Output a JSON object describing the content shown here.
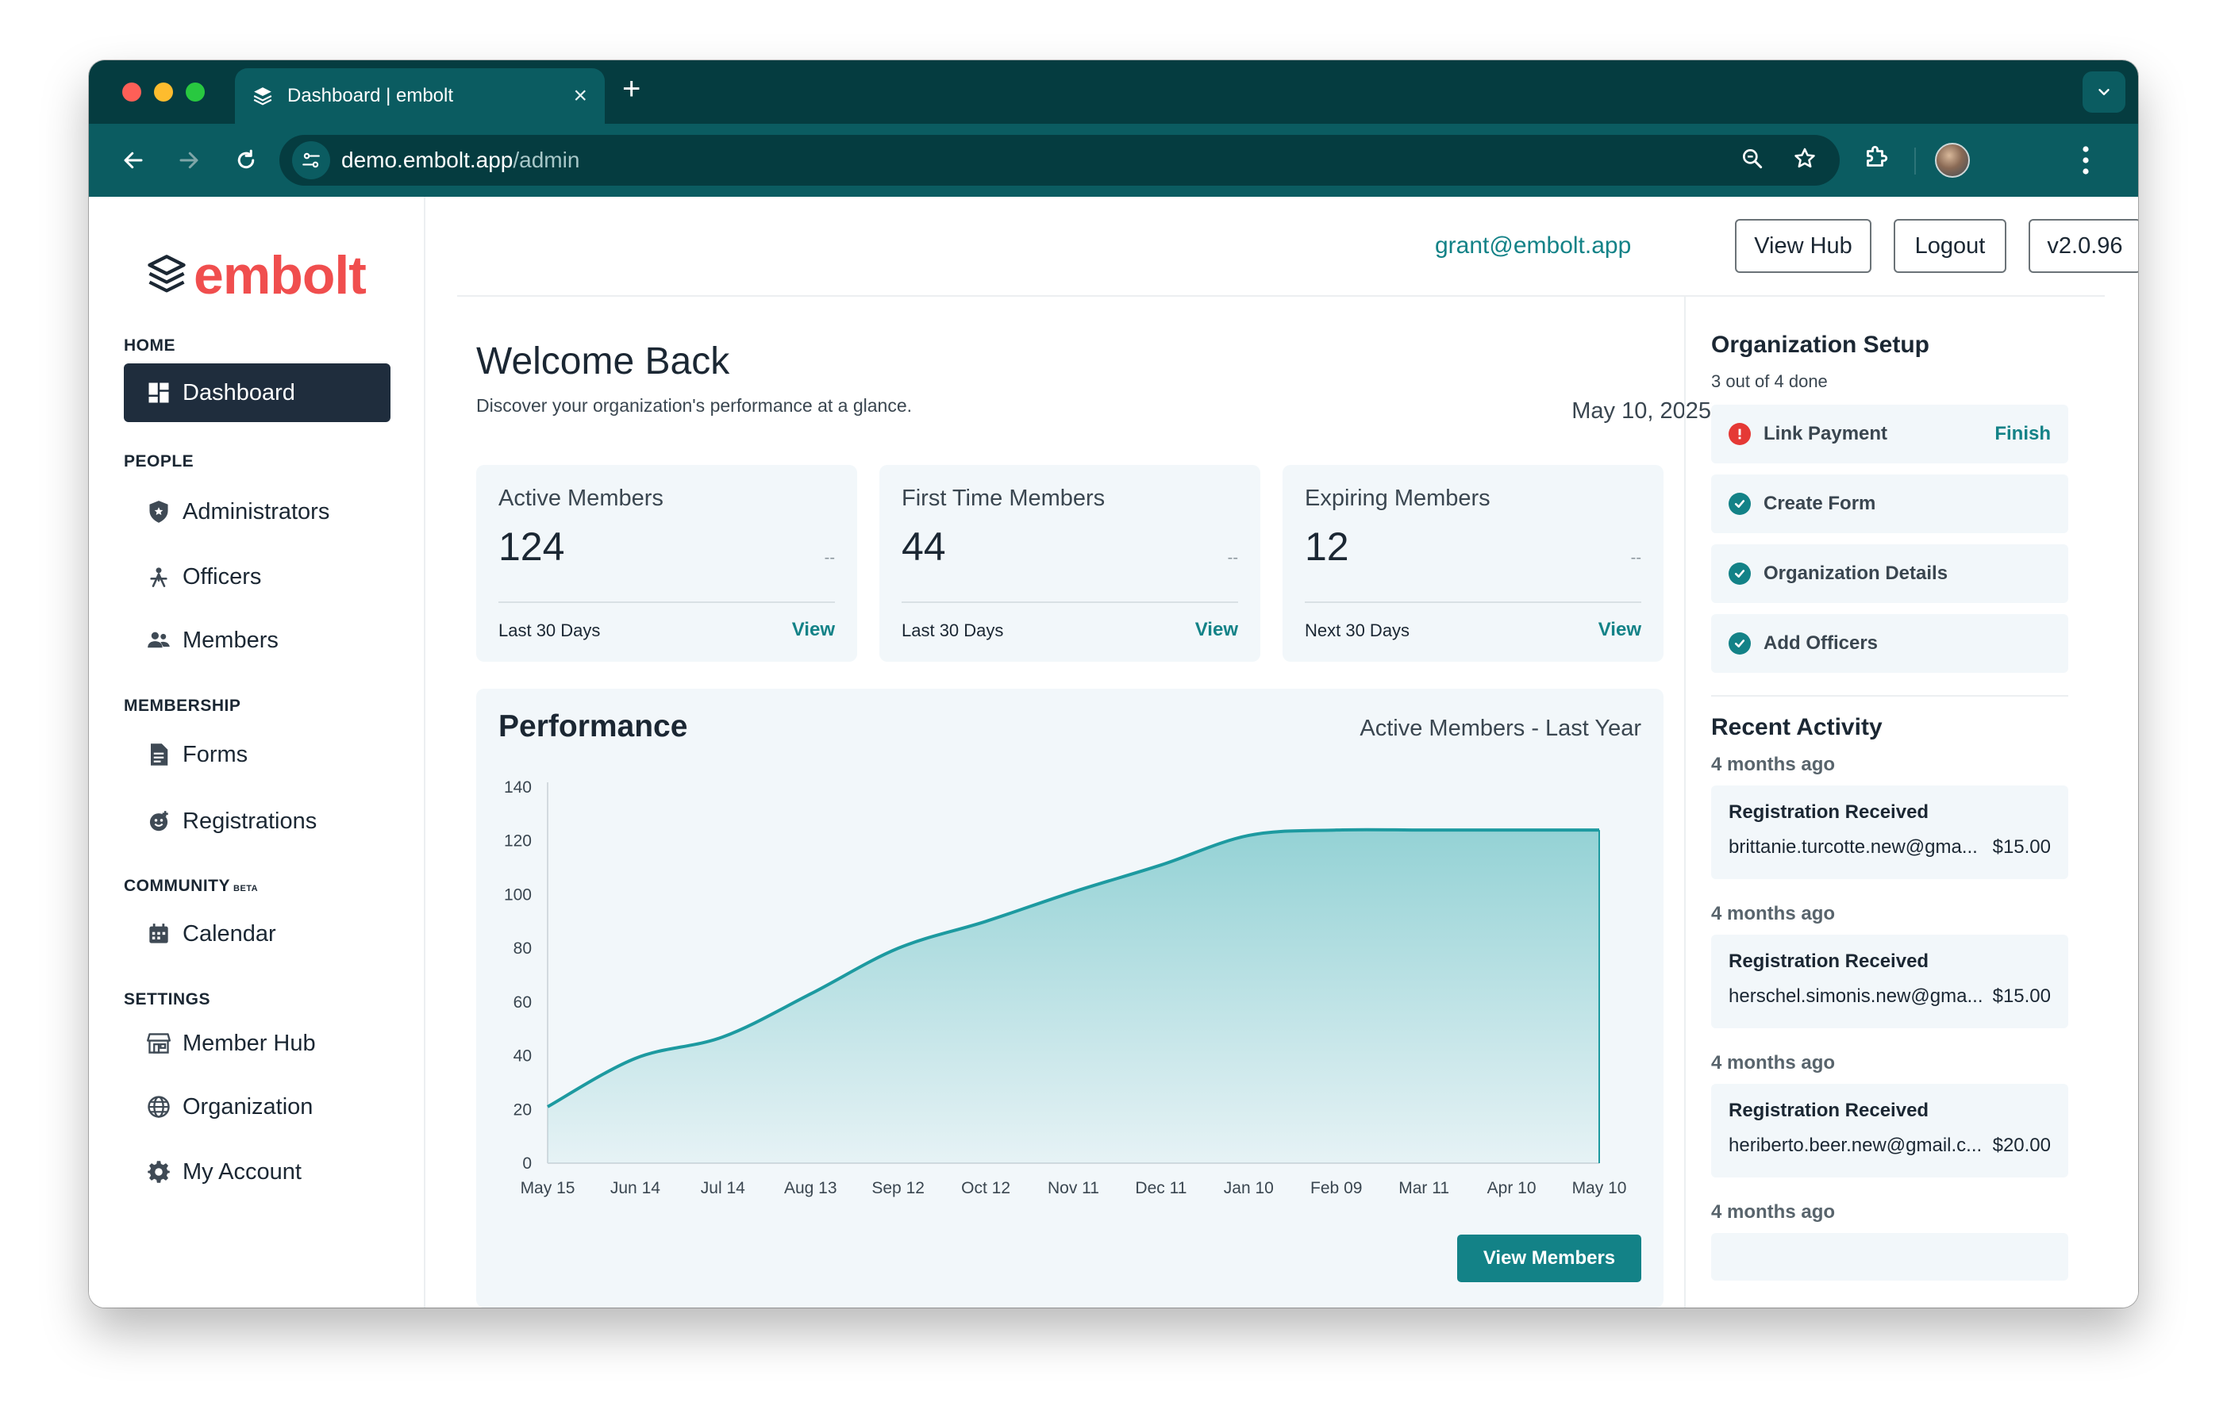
{
  "browser": {
    "tab_title": "Dashboard | embolt",
    "url_host": "demo.embolt.app",
    "url_path": "/admin"
  },
  "brand": {
    "name": "embolt",
    "color": "#f04e4e"
  },
  "sidebar": {
    "home_label": "HOME",
    "dashboard": "Dashboard",
    "people_label": "PEOPLE",
    "administrators": "Administrators",
    "officers": "Officers",
    "members": "Members",
    "membership_label": "MEMBERSHIP",
    "forms": "Forms",
    "registrations": "Registrations",
    "community_label": "COMMUNITY",
    "community_badge": "BETA",
    "calendar": "Calendar",
    "settings_label": "SETTINGS",
    "member_hub": "Member Hub",
    "organization": "Organization",
    "my_account": "My Account"
  },
  "header": {
    "user_email": "grant@embolt.app",
    "view_hub": "View Hub",
    "logout": "Logout",
    "version": "v2.0.96"
  },
  "main": {
    "welcome": "Welcome Back",
    "subtitle": "Discover your organization's performance at a glance.",
    "date": "May 10, 2025",
    "stats": [
      {
        "title": "Active Members",
        "value": "124",
        "trend": "--",
        "period": "Last 30 Days",
        "link": "View"
      },
      {
        "title": "First Time Members",
        "value": "44",
        "trend": "--",
        "period": "Last 30 Days",
        "link": "View"
      },
      {
        "title": "Expiring Members",
        "value": "12",
        "trend": "--",
        "period": "Next 30 Days",
        "link": "View"
      }
    ],
    "performance": {
      "title": "Performance",
      "subtitle": "Active Members - Last Year",
      "button": "View Members"
    }
  },
  "chart_data": {
    "type": "area",
    "title": "Performance",
    "subtitle": "Active Members - Last Year",
    "x": [
      "May 15",
      "Jun 14",
      "Jul 14",
      "Aug 13",
      "Sep 12",
      "Oct 12",
      "Nov 11",
      "Dec 11",
      "Jan 10",
      "Feb 09",
      "Mar 11",
      "Apr 10",
      "May 10"
    ],
    "series": [
      {
        "values": [
          21,
          39,
          47,
          63,
          80,
          90,
          101,
          111,
          122,
          124,
          124,
          124,
          124
        ]
      }
    ],
    "yticks": [
      0,
      20,
      40,
      60,
      80,
      100,
      120,
      140
    ],
    "ylim": [
      0,
      140
    ],
    "grid": false,
    "line_color": "#1d9aa0",
    "fill_color": "#8fd0d3"
  },
  "setup": {
    "title": "Organization Setup",
    "progress": "3 out of 4 done",
    "items": [
      {
        "label": "Link Payment",
        "status": "incomplete",
        "action": "Finish"
      },
      {
        "label": "Create Form",
        "status": "done"
      },
      {
        "label": "Organization Details",
        "status": "done"
      },
      {
        "label": "Add Officers",
        "status": "done"
      }
    ]
  },
  "activity": {
    "title": "Recent Activity",
    "items": [
      {
        "time": "4 months ago",
        "title": "Registration Received",
        "email": "brittanie.turcotte.new@gma...",
        "amount": "$15.00"
      },
      {
        "time": "4 months ago",
        "title": "Registration Received",
        "email": "herschel.simonis.new@gma...",
        "amount": "$15.00"
      },
      {
        "time": "4 months ago",
        "title": "Registration Received",
        "email": "heriberto.beer.new@gmail.c...",
        "amount": "$20.00"
      },
      {
        "time": "4 months ago"
      }
    ]
  }
}
